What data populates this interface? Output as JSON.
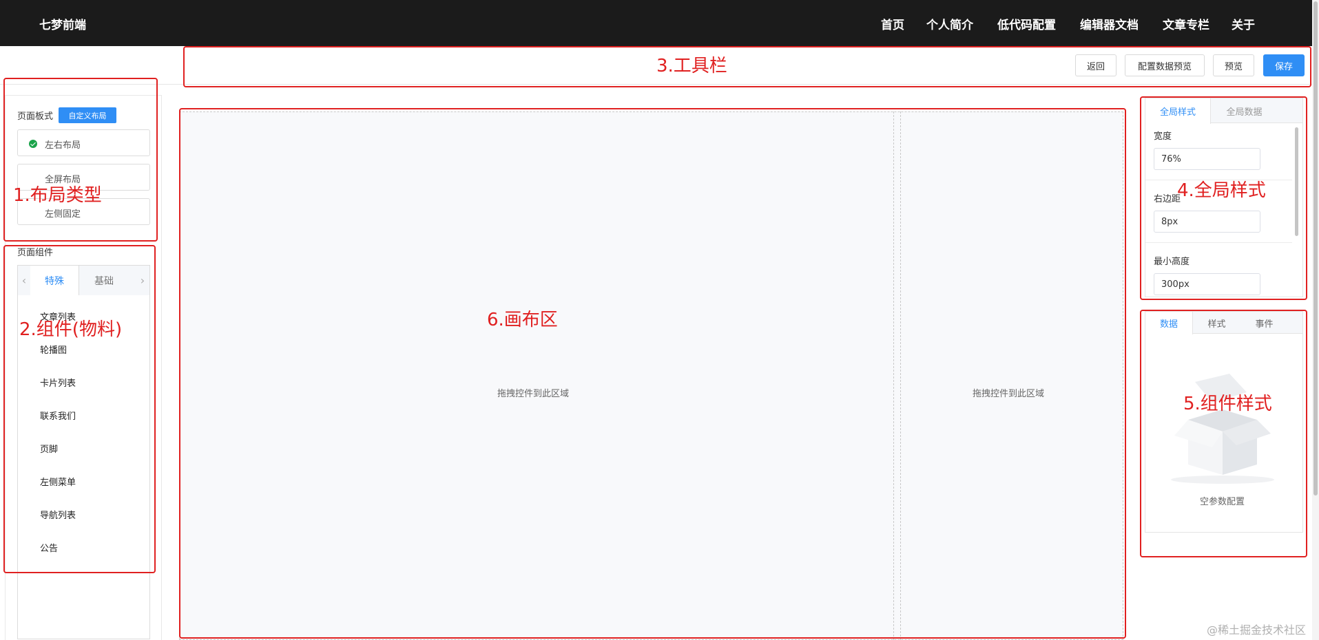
{
  "header": {
    "brand": "七梦前端",
    "nav": [
      "首页",
      "个人简介",
      "低代码配置",
      "编辑器文档",
      "文章专栏",
      "关于"
    ]
  },
  "toolbar": {
    "back": "返回",
    "config_preview": "配置数据预览",
    "preview": "预览",
    "save": "保存"
  },
  "left_panel": {
    "layout_label": "页面板式",
    "custom_layout": "自定义布局",
    "layout_options": [
      {
        "label": "左右布局",
        "selected": true
      },
      {
        "label": "全屏布局",
        "selected": false
      },
      {
        "label": "左侧固定",
        "selected": false
      }
    ],
    "components_label": "页面组件",
    "tabs": [
      "特殊",
      "基础"
    ],
    "active_tab": "特殊",
    "components": [
      "文章列表",
      "轮播图",
      "卡片列表",
      "联系我们",
      "页脚",
      "左侧菜单",
      "导航列表",
      "公告"
    ]
  },
  "canvas": {
    "drop_hint_left": "拖拽控件到此区域",
    "drop_hint_right": "拖拽控件到此区域"
  },
  "global_style": {
    "tabs": [
      "全局样式",
      "全局数据"
    ],
    "active_tab": "全局样式",
    "fields": [
      {
        "label": "宽度",
        "value": "76%"
      },
      {
        "label": "右边距",
        "value": "8px"
      },
      {
        "label": "最小高度",
        "value": "300px"
      }
    ]
  },
  "component_style": {
    "tabs": [
      "数据",
      "样式",
      "事件"
    ],
    "active_tab": "数据",
    "empty_text": "空参数配置"
  },
  "annotations": {
    "layout_type": "1.布局类型",
    "components": "2.组件(物料)",
    "toolbar": "3.工具栏",
    "global_style": "4.全局样式",
    "component_style": "5.组件样式",
    "canvas": "6.画布区"
  },
  "watermark": "@稀土掘金技术社区",
  "colors": {
    "header_bg": "#1b1b1b",
    "primary": "#2f8ef5",
    "annotation": "#e02020",
    "check": "#1aa34a"
  }
}
